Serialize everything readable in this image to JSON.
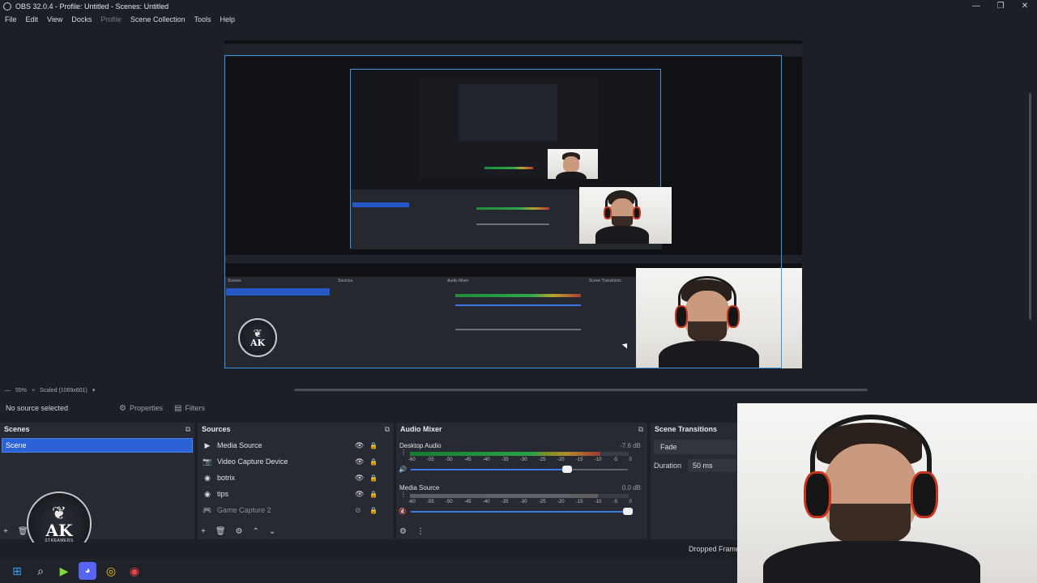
{
  "window": {
    "title": "OBS 32.0.4 - Profile: Untitled - Scenes: Untitled",
    "minimize": "—",
    "maximize": "❐",
    "close": "✕"
  },
  "menu": {
    "file": "File",
    "edit": "Edit",
    "view": "View",
    "docks": "Docks",
    "profile": "Profile",
    "scene_collection": "Scene Collection",
    "tools": "Tools",
    "help": "Help"
  },
  "preview": {
    "zoom": "55%",
    "zoom_plus": "+",
    "scale_mode": "Scaled (1069x601)",
    "logo_text": "AK",
    "logo_sub": "STREAMERS"
  },
  "source_toolbar": {
    "no_source": "No source selected",
    "properties": "Properties",
    "filters": "Filters"
  },
  "scenes": {
    "title": "Scenes",
    "items": [
      "Scene"
    ]
  },
  "sources": {
    "title": "Sources",
    "items": [
      {
        "name": "Media Source",
        "icon": "play-icon",
        "visible": true
      },
      {
        "name": "Video Capture Device",
        "icon": "camera-icon",
        "visible": true
      },
      {
        "name": "botrix",
        "icon": "globe-icon",
        "visible": true
      },
      {
        "name": "tips",
        "icon": "globe-icon",
        "visible": true
      },
      {
        "name": "Game Capture 2",
        "icon": "gamepad-icon",
        "visible": false
      }
    ]
  },
  "audio_mixer": {
    "title": "Audio Mixer",
    "channels": [
      {
        "name": "Desktop Audio",
        "db": "-7.6 dB",
        "level": 0.87,
        "volume": 0.72,
        "muted": false
      },
      {
        "name": "Media Source",
        "db": "0.0 dB",
        "level": 0.86,
        "volume": 1.0,
        "muted": true
      }
    ],
    "ticks": [
      "-60",
      "-55",
      "-50",
      "-45",
      "-40",
      "-35",
      "-30",
      "-25",
      "-20",
      "-15",
      "-10",
      "-5",
      "0"
    ]
  },
  "scene_transitions": {
    "title": "Scene Transitions",
    "transition": "Fade",
    "duration_label": "Duration",
    "duration_value": "50 ms"
  },
  "status": {
    "dropped_frames": "Dropped Frame"
  },
  "colors": {
    "accent": "#2b63d6",
    "selection": "#3b95e4",
    "panel": "#272a33",
    "background": "#1d1f26"
  }
}
